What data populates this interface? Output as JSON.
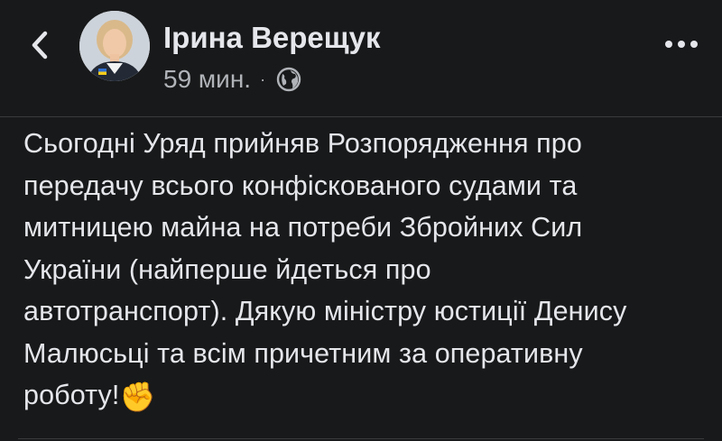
{
  "post": {
    "author": "Ірина Верещук",
    "time": "59 мин.",
    "separator": "·",
    "text": "Сьогодні Уряд прийняв Розпорядження про\nпередачу всього конфіскованого судами та\nмитницею майна на потреби Збройних Сил\nУкраїни (найперше йдеться про\nавтотранспорт). Дякую міністру юстиції Денису\nМалюсьці та всім причетним за оперативну\nроботу!",
    "emoji": "✊"
  },
  "icons": {
    "back": "chevron-left-icon",
    "privacy": "globe-icon",
    "more": "more-horizontal-icon",
    "emoji": "raised-fist-icon"
  },
  "colors": {
    "background": "#18191a",
    "primary_text": "#e4e6eb",
    "secondary_text": "#b0b3b8"
  }
}
